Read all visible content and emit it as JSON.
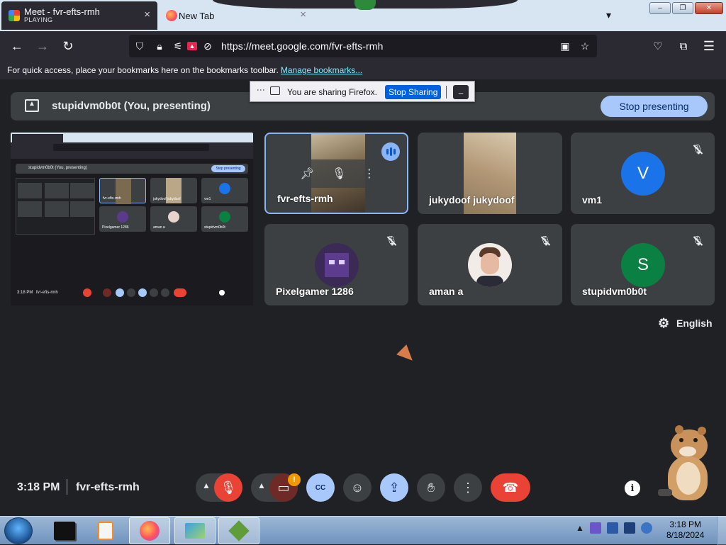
{
  "browser": {
    "tabs": [
      {
        "title": "Meet - fvr-efts-rmh",
        "subtitle": "PLAYING",
        "close": "×"
      },
      {
        "title": "New Tab",
        "close": "×"
      }
    ],
    "list_tabs_icon": "chevron-down-icon",
    "window_controls": {
      "minimize": "–",
      "maximize": "❐",
      "close": "✕"
    },
    "nav": {
      "back": "←",
      "forward": "→",
      "reload": "↻"
    },
    "url": "https://meet.google.com/fvr-efts-rmh",
    "bookmarks": {
      "text": "For quick access, place your bookmarks here on the bookmarks toolbar.",
      "link": "Manage bookmarks..."
    }
  },
  "sharing_popup": {
    "text": "You are sharing Firefox.",
    "stop_label": "Stop Sharing",
    "minimize_label": "_"
  },
  "meet": {
    "presenter": "stupidvm0b0t (You, presenting)",
    "stop_presenting_label": "Stop presenting",
    "participants": [
      {
        "name": "fvr-efts-rmh",
        "speaking": true
      },
      {
        "name": "jukydoof jukydoof"
      },
      {
        "name": "vm1",
        "initial": "V",
        "color": "#1a73e8"
      },
      {
        "name": "Pixelgamer 1286"
      },
      {
        "name": "aman a"
      },
      {
        "name": "stupidvm0b0t",
        "initial": "S",
        "color": "#0b8043"
      }
    ],
    "caption_language": "English",
    "time": "3:18 PM",
    "meeting_code": "fvr-efts-rmh",
    "notification_badge": "!",
    "captions_label": "CC"
  },
  "preview": {
    "presenter": "stupidvm0b0t (You, presenting)",
    "stop_label": "Stop presenting",
    "names": [
      "fvr-efts-rmh",
      "jukydoof jukydoof",
      "vm1",
      "Pixelgamer 1286",
      "aman a",
      "stupidvm0b0t"
    ],
    "time": "3:18 PM",
    "code": "fvr-efts-rmh"
  },
  "taskbar": {
    "time": "3:18 PM",
    "date": "8/18/2024"
  }
}
